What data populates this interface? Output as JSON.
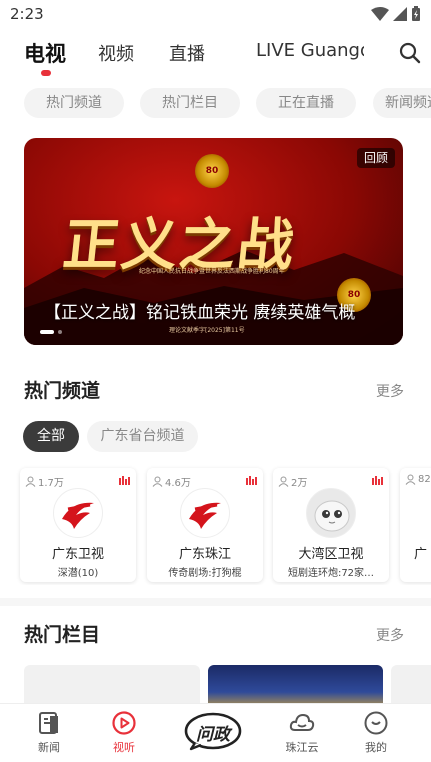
{
  "status_bar": {
    "time": "2:23"
  },
  "top_nav": {
    "tabs": [
      "电视",
      "视频",
      "直播",
      "LIVE Guangdong"
    ],
    "active_index": 0
  },
  "chips": [
    "热门频道",
    "热门栏目",
    "正在直播",
    "新闻频道"
  ],
  "banner": {
    "badge": "回顾",
    "art_title": "正义之战",
    "art_subtitle": "纪念中国人民抗日战争暨世界反法西斯战争胜利80周年",
    "emblem_text": "80",
    "caption": "【正义之战】铭记铁血荣光 赓续英雄气概",
    "doc_number": "理论文献季字[2025]第11号",
    "slide_count": 2,
    "active_slide": 0
  },
  "hot_channels": {
    "title": "热门频道",
    "more": "更多",
    "filters": [
      "全部",
      "广东省台频道"
    ],
    "active_filter": 0,
    "channels": [
      {
        "viewers": "1.7万",
        "name": "广东卫视",
        "program": "深潜(10)",
        "logo": "guangdong-tv-logo"
      },
      {
        "viewers": "4.6万",
        "name": "广东珠江",
        "program": "传奇剧场:打狗棍",
        "logo": "guangdong-tv-logo"
      },
      {
        "viewers": "2万",
        "name": "大湾区卫视",
        "program": "短剧连环炮:72家…",
        "logo": "bay-area-mascot-logo"
      },
      {
        "viewers": "82",
        "name": "广",
        "program": "",
        "logo": "generic-logo"
      }
    ]
  },
  "hot_columns": {
    "title": "热门栏目",
    "more": "更多"
  },
  "bottom_nav": {
    "items": [
      {
        "label": "新闻",
        "icon": "news-icon"
      },
      {
        "label": "视听",
        "icon": "play-circle-icon"
      },
      {
        "label": "问政",
        "icon": "wenzheng-icon"
      },
      {
        "label": "珠江云",
        "icon": "cloud-icon"
      },
      {
        "label": "我的",
        "icon": "profile-icon"
      }
    ],
    "active_index": 1
  },
  "colors": {
    "accent": "#e8313a",
    "pill_active": "#3b3b3b",
    "chip_bg": "#f3f3f3"
  }
}
